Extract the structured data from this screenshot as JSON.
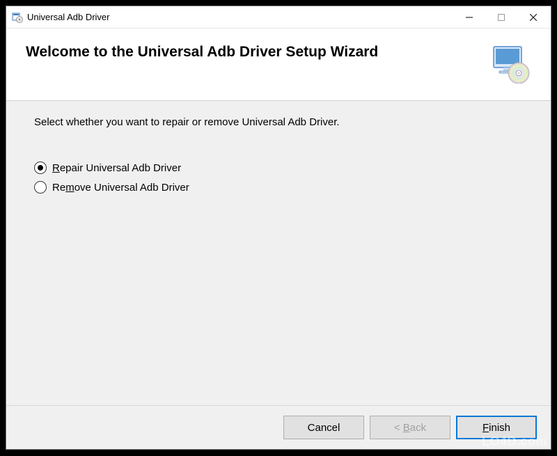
{
  "titlebar": {
    "title": "Universal Adb Driver"
  },
  "header": {
    "title": "Welcome to the Universal Adb Driver Setup Wizard"
  },
  "content": {
    "instruction": "Select whether you want to repair or remove Universal Adb Driver.",
    "options": [
      {
        "label_prefix": "",
        "label_accel": "R",
        "label_suffix": "epair Universal Adb Driver",
        "selected": true
      },
      {
        "label_prefix": "Re",
        "label_accel": "m",
        "label_suffix": "ove Universal Adb Driver",
        "selected": false
      }
    ]
  },
  "footer": {
    "cancel": "Cancel",
    "back_prefix": "< ",
    "back_accel": "B",
    "back_suffix": "ack",
    "finish_prefix": "",
    "finish_accel": "F",
    "finish_suffix": "inish"
  },
  "watermark": "LO4D.com"
}
